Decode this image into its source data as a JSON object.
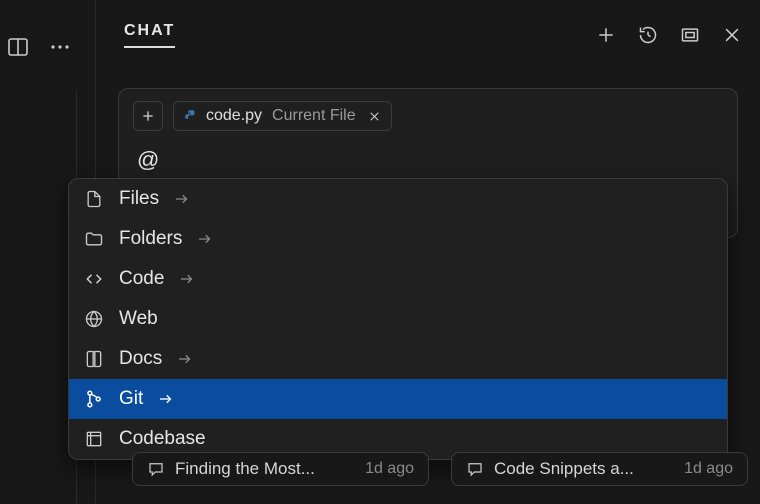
{
  "header": {
    "title": "CHAT"
  },
  "input": {
    "current_file": {
      "name": "code.py",
      "hint": "Current File"
    },
    "text": "@"
  },
  "context_menu": {
    "items": [
      {
        "id": "files",
        "label": "Files",
        "has_submenu": true,
        "selected": false
      },
      {
        "id": "folders",
        "label": "Folders",
        "has_submenu": true,
        "selected": false
      },
      {
        "id": "code",
        "label": "Code",
        "has_submenu": true,
        "selected": false
      },
      {
        "id": "web",
        "label": "Web",
        "has_submenu": false,
        "selected": false
      },
      {
        "id": "docs",
        "label": "Docs",
        "has_submenu": true,
        "selected": false
      },
      {
        "id": "git",
        "label": "Git",
        "has_submenu": true,
        "selected": true
      },
      {
        "id": "codebase",
        "label": "Codebase",
        "has_submenu": false,
        "selected": false
      }
    ]
  },
  "recents": [
    {
      "title": "Finding the Most...",
      "time": "1d ago"
    },
    {
      "title": "Code Snippets a...",
      "time": "1d ago"
    }
  ]
}
